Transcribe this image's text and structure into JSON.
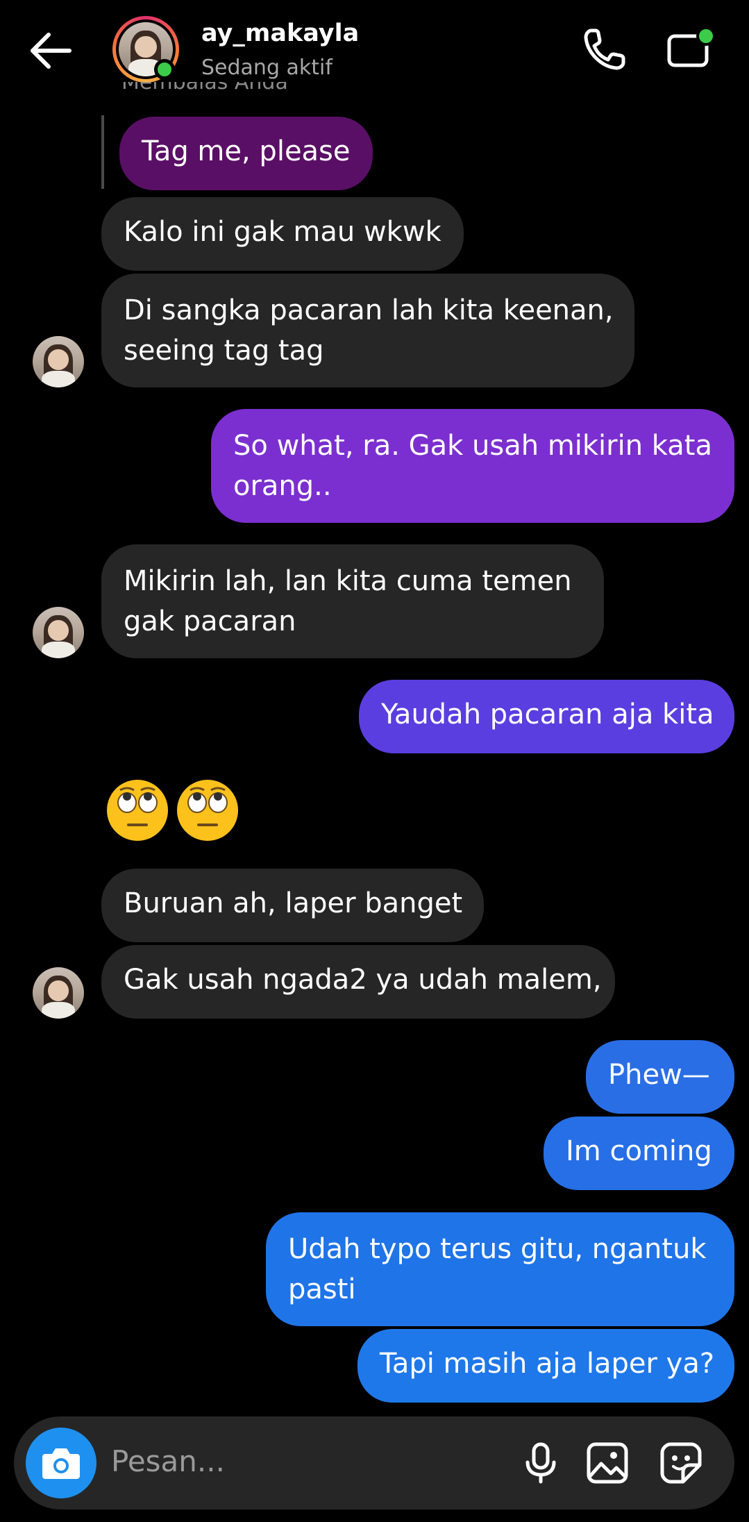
{
  "header": {
    "username": "ay_makayla",
    "status": "Sedang aktif",
    "icons": [
      "back-arrow-icon",
      "phone-icon",
      "video-call-icon"
    ]
  },
  "thread": {
    "reply_context": "Membalas Anda",
    "messages": [
      {
        "from": "them",
        "text": "Tag me, please"
      },
      {
        "from": "them",
        "text": "Kalo ini gak mau wkwk"
      },
      {
        "from": "them",
        "line1": "Di sangka pacaran lah kita keenan,",
        "line2": "seeing tag tag"
      },
      {
        "from": "me",
        "line1": "So what, ra. Gak usah mikirin kata",
        "line2": "orang.."
      },
      {
        "from": "them",
        "line1": "Mikirin lah, lan kita cuma temen",
        "line2": "gak pacaran"
      },
      {
        "from": "me",
        "text": "Yaudah pacaran aja kita"
      },
      {
        "from": "them",
        "emoji": "face-with-rolling-eyes x2"
      },
      {
        "from": "them",
        "text": "Buruan ah, laper banget"
      },
      {
        "from": "them",
        "text": "Gak usah ngada2 ya udah malem,"
      },
      {
        "from": "me",
        "text": "Phew—"
      },
      {
        "from": "me",
        "text": "Im coming"
      },
      {
        "from": "me",
        "line1": "Udah typo terus gitu, ngantuk",
        "line2": "pasti"
      },
      {
        "from": "me",
        "text": "Tapi masih aja laper ya?"
      }
    ]
  },
  "composer": {
    "placeholder": "Pesan..."
  },
  "colors": {
    "background": "#000000",
    "incoming_bubble": "#262626",
    "reply_quote_bubble": "#5a0f66",
    "outgoing_purple": "#7b2fd0",
    "outgoing_indigo": "#5b3ee0",
    "outgoing_blue": "#1f74e8",
    "camera_button": "#1e90f0",
    "online": "#3ccc4a"
  }
}
